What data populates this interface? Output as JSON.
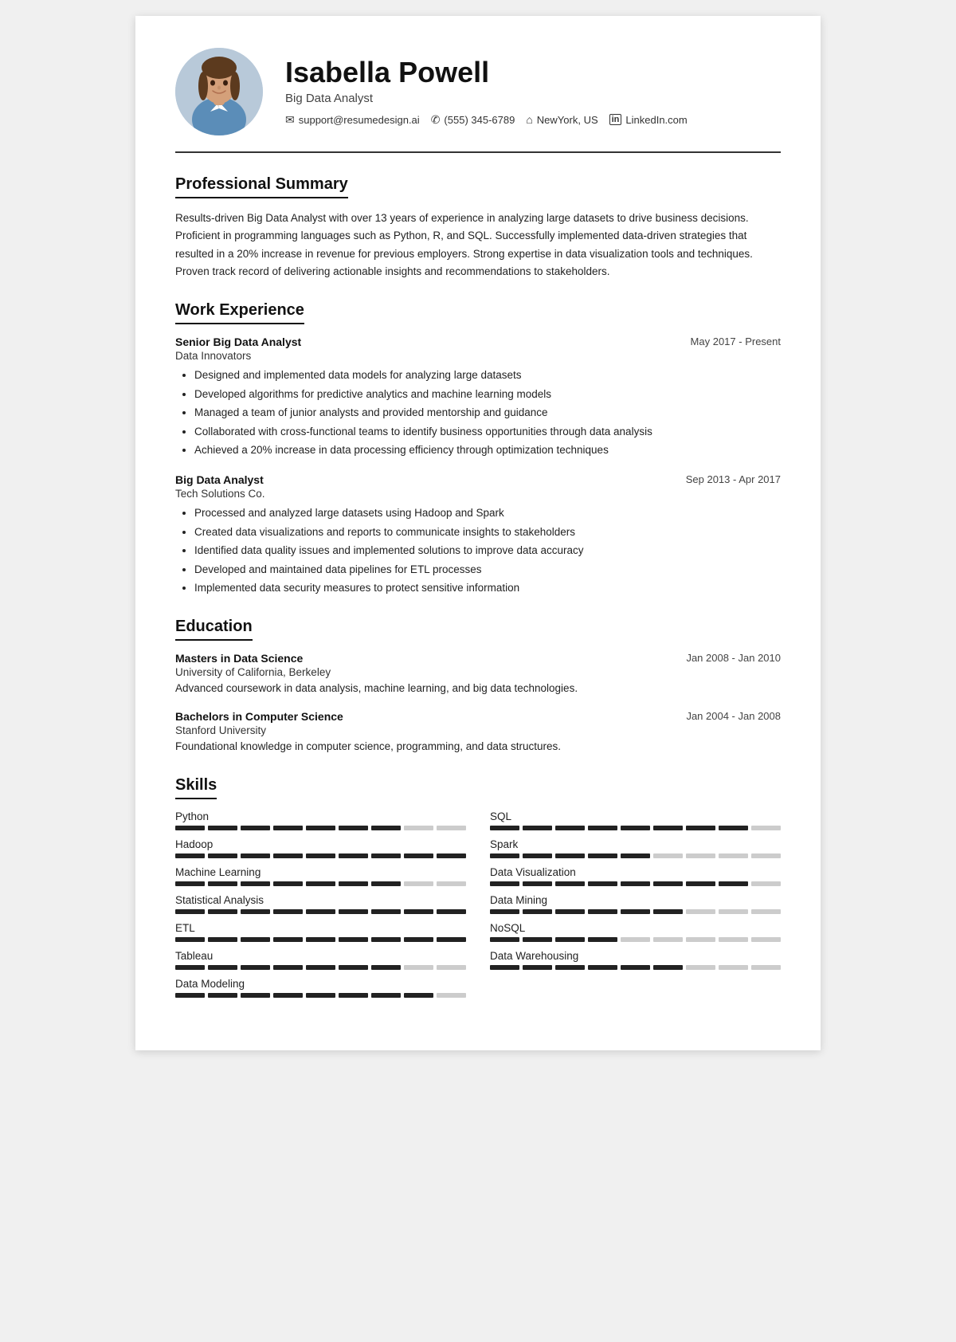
{
  "header": {
    "name": "Isabella Powell",
    "title": "Big Data Analyst",
    "contacts": [
      {
        "icon": "✉",
        "label": "support@resumedesign.ai",
        "type": "email"
      },
      {
        "icon": "✆",
        "label": "(555) 345-6789",
        "type": "phone"
      },
      {
        "icon": "⌂",
        "label": "NewYork, US",
        "type": "location"
      },
      {
        "icon": "in",
        "label": "LinkedIn.com",
        "type": "linkedin"
      }
    ]
  },
  "sections": {
    "summary": {
      "title": "Professional Summary",
      "text": "Results-driven Big Data Analyst with over 13 years of experience in analyzing large datasets to drive business decisions. Proficient in programming languages such as Python, R, and SQL. Successfully implemented data-driven strategies that resulted in a 20% increase in revenue for previous employers. Strong expertise in data visualization tools and techniques. Proven track record of delivering actionable insights and recommendations to stakeholders."
    },
    "work": {
      "title": "Work Experience",
      "jobs": [
        {
          "title": "Senior Big Data Analyst",
          "company": "Data Innovators",
          "date": "May 2017 - Present",
          "bullets": [
            "Designed and implemented data models for analyzing large datasets",
            "Developed algorithms for predictive analytics and machine learning models",
            "Managed a team of junior analysts and provided mentorship and guidance",
            "Collaborated with cross-functional teams to identify business opportunities through data analysis",
            "Achieved a 20% increase in data processing efficiency through optimization techniques"
          ]
        },
        {
          "title": "Big Data Analyst",
          "company": "Tech Solutions Co.",
          "date": "Sep 2013 - Apr 2017",
          "bullets": [
            "Processed and analyzed large datasets using Hadoop and Spark",
            "Created data visualizations and reports to communicate insights to stakeholders",
            "Identified data quality issues and implemented solutions to improve data accuracy",
            "Developed and maintained data pipelines for ETL processes",
            "Implemented data security measures to protect sensitive information"
          ]
        }
      ]
    },
    "education": {
      "title": "Education",
      "entries": [
        {
          "degree": "Masters in Data Science",
          "school": "University of California, Berkeley",
          "date": "Jan 2008 - Jan 2010",
          "desc": "Advanced coursework in data analysis, machine learning, and big data technologies."
        },
        {
          "degree": "Bachelors in Computer Science",
          "school": "Stanford University",
          "date": "Jan 2004 - Jan 2008",
          "desc": "Foundational knowledge in computer science, programming, and data structures."
        }
      ]
    },
    "skills": {
      "title": "Skills",
      "items": [
        {
          "name": "Python",
          "filled": 7,
          "total": 9
        },
        {
          "name": "SQL",
          "filled": 8,
          "total": 9
        },
        {
          "name": "Hadoop",
          "filled": 9,
          "total": 9
        },
        {
          "name": "Spark",
          "filled": 5,
          "total": 9
        },
        {
          "name": "Machine Learning",
          "filled": 7,
          "total": 9
        },
        {
          "name": "Data Visualization",
          "filled": 8,
          "total": 9
        },
        {
          "name": "Statistical Analysis",
          "filled": 9,
          "total": 9
        },
        {
          "name": "Data Mining",
          "filled": 6,
          "total": 9
        },
        {
          "name": "ETL",
          "filled": 9,
          "total": 9
        },
        {
          "name": "NoSQL",
          "filled": 4,
          "total": 9
        },
        {
          "name": "Tableau",
          "filled": 7,
          "total": 9
        },
        {
          "name": "Data Warehousing",
          "filled": 6,
          "total": 9
        },
        {
          "name": "Data Modeling",
          "filled": 8,
          "total": 9
        }
      ]
    }
  }
}
